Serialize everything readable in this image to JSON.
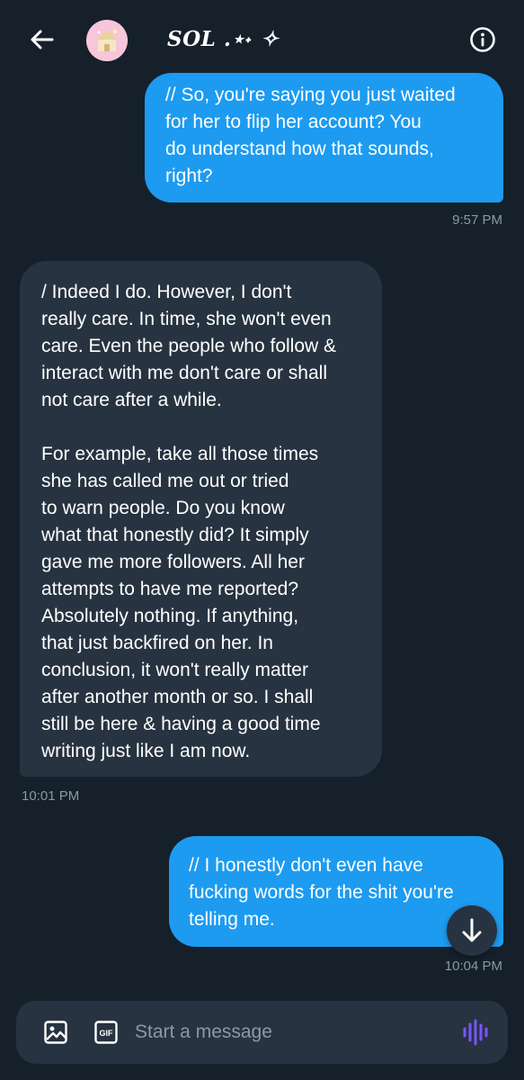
{
  "header": {
    "title": "SOL .⋆˖ ✧",
    "back_icon": "arrow-left-icon",
    "info_icon": "info-circle-icon"
  },
  "messages": [
    {
      "direction": "outgoing",
      "text": "// So, you're saying you just waited\nfor her to flip her account? You\ndo understand how that sounds,\nright?",
      "time": "9:57 PM"
    },
    {
      "direction": "incoming",
      "text": "/ Indeed I do. However, I don't\nreally care. In time, she won't even\ncare. Even the people who follow &\ninteract with me don't care or shall\nnot care after a while.\n\nFor example, take all those times\nshe has called me out or tried\nto warn people. Do you know\nwhat that honestly did? It simply\ngave me more followers. All her\nattempts to have me reported?\nAbsolutely nothing. If anything,\nthat just backfired on her. In\nconclusion, it won't really matter\nafter another month or so. I shall\nstill be here & having a good time\nwriting just like I am now.",
      "time": "10:01 PM"
    },
    {
      "direction": "outgoing",
      "text": "// I honestly don't even have\nfucking words for the shit you're\ntelling me.",
      "time": "10:04 PM"
    }
  ],
  "composer": {
    "placeholder": "Start a message",
    "value": "",
    "gif_label": "GIF"
  },
  "colors": {
    "background": "#15202b",
    "outgoing_bubble": "#1d9bf0",
    "incoming_bubble": "#273340",
    "muted_text": "#8b98a5",
    "voice_accent": "#7856ff"
  }
}
